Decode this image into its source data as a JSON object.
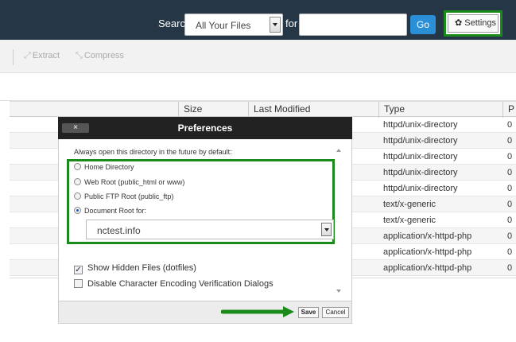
{
  "topbar": {
    "search_label": "Search",
    "search_scope_value": "All Your Files",
    "for_label": "for",
    "search_query": "",
    "go_label": "Go",
    "settings_label": "Settings",
    "settings_icon": "gear-icon"
  },
  "toolbar": {
    "extract_label": "Extract",
    "extract_icon": "extract-icon",
    "compress_label": "Compress",
    "compress_icon": "compress-icon"
  },
  "table": {
    "headers": [
      "Size",
      "Last Modified",
      "Type",
      "P"
    ],
    "rows": [
      {
        "size": "",
        "modified": "",
        "type": "httpd/unix-directory",
        "perm": "0"
      },
      {
        "size": "",
        "modified": "",
        "type": "httpd/unix-directory",
        "perm": "0"
      },
      {
        "size": "",
        "modified": "",
        "type": "httpd/unix-directory",
        "perm": "0"
      },
      {
        "size": "",
        "modified": "",
        "type": "httpd/unix-directory",
        "perm": "0"
      },
      {
        "size": "",
        "modified": "",
        "type": "httpd/unix-directory",
        "perm": "0"
      },
      {
        "size": "",
        "modified": "",
        "type": "text/x-generic",
        "perm": "0"
      },
      {
        "size": "",
        "modified": "",
        "type": "text/x-generic",
        "perm": "0"
      },
      {
        "size": "",
        "modified": "",
        "type": "application/x-httpd-php",
        "perm": "0"
      },
      {
        "size": "",
        "modified": "",
        "type": "application/x-httpd-php",
        "perm": "0"
      },
      {
        "size": "",
        "modified": "",
        "type": "application/x-httpd-php",
        "perm": "0"
      }
    ]
  },
  "dialog": {
    "close_label": "×",
    "title": "Preferences",
    "intro": "Always open this directory in the future by default:",
    "radios": [
      {
        "label": "Home Directory",
        "selected": false
      },
      {
        "label": "Web Root (public_html or www)",
        "selected": false
      },
      {
        "label": "Public FTP Root (public_ftp)",
        "selected": false
      },
      {
        "label": "Document Root for:",
        "selected": true
      }
    ],
    "domain_value": "nctest.info",
    "checks": [
      {
        "label": "Show Hidden Files (dotfiles)",
        "checked": true
      },
      {
        "label": "Disable Character Encoding Verification Dialogs",
        "checked": false
      }
    ],
    "save_label": "Save",
    "cancel_label": "Cancel"
  },
  "colors": {
    "topbar": "#253647",
    "go_button": "#2a8fd6",
    "highlight": "#1a8a1a",
    "dialog_header": "#222222"
  }
}
